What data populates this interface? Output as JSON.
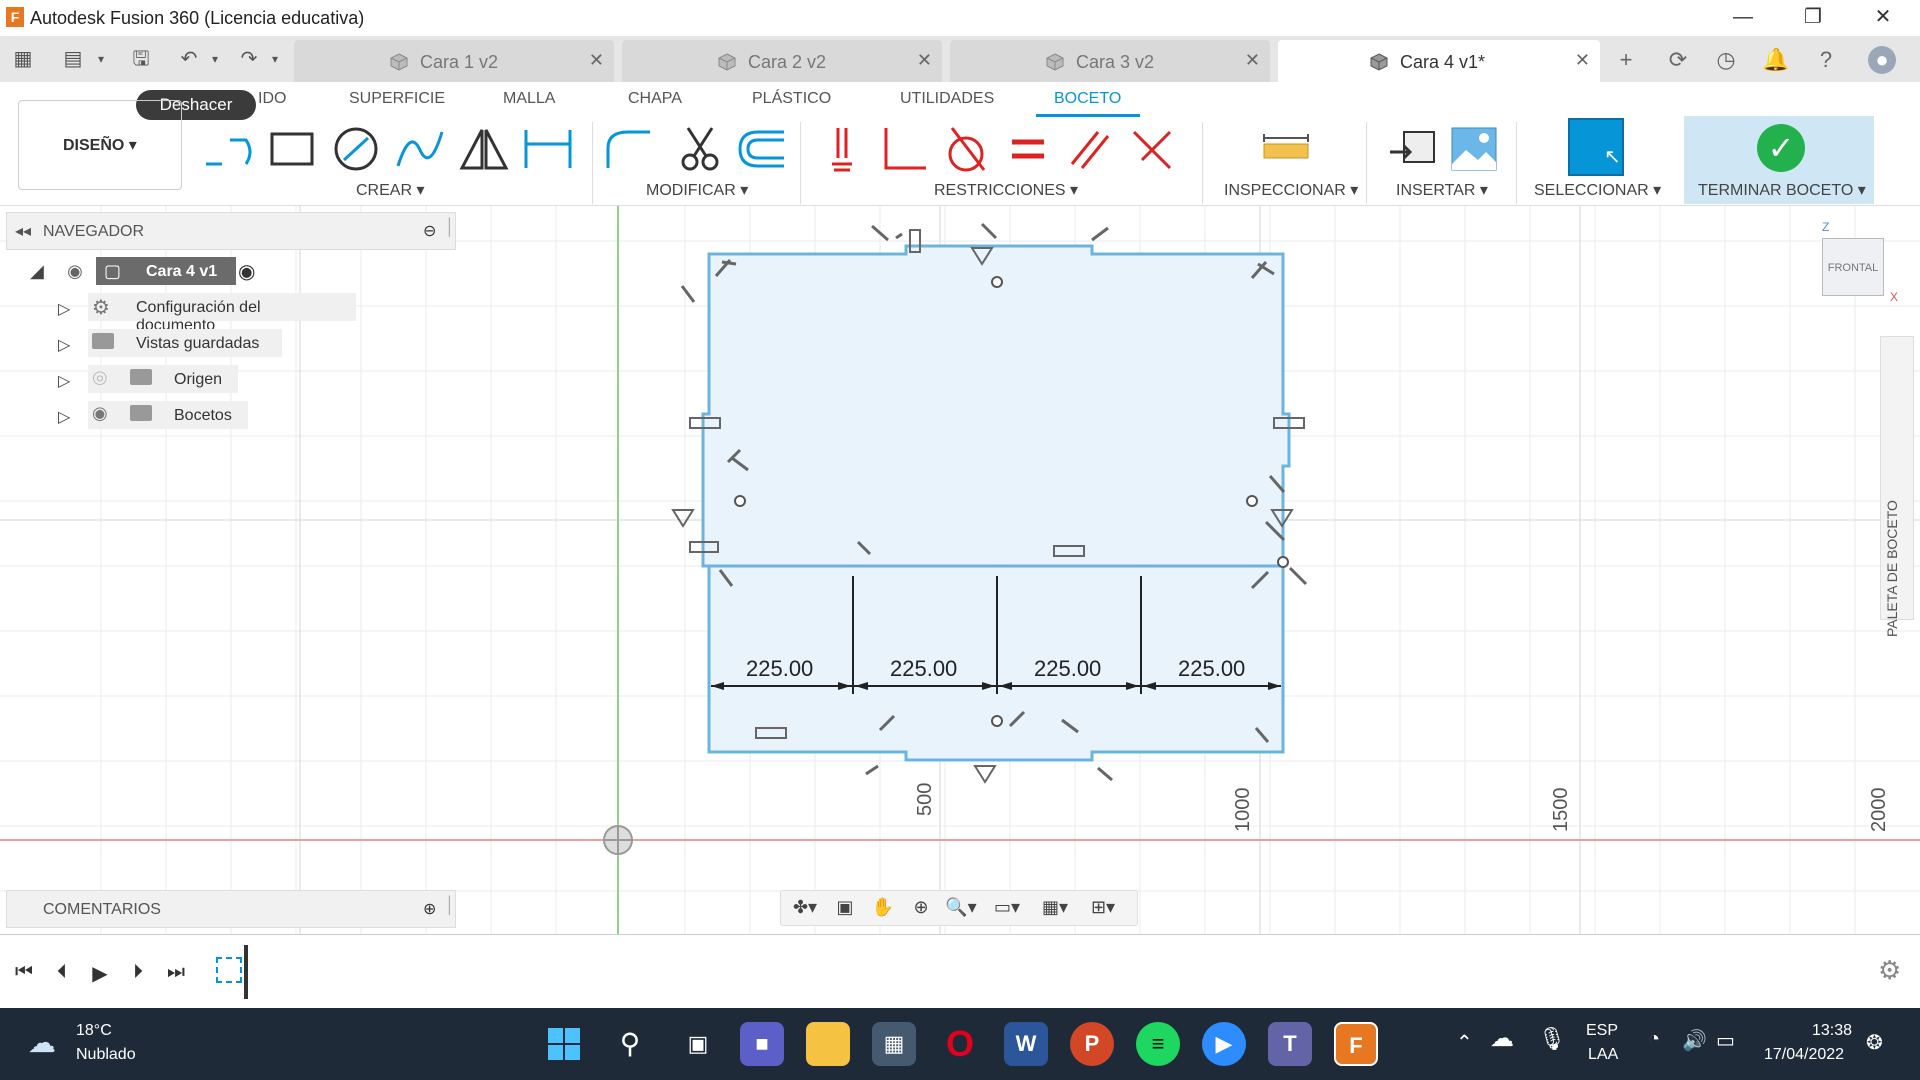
{
  "window": {
    "title": "Autodesk Fusion 360 (Licencia educativa)",
    "app_logo": "F"
  },
  "tabs": [
    {
      "label": "Cara 1 v2",
      "active": false
    },
    {
      "label": "Cara 2 v2",
      "active": false
    },
    {
      "label": "Cara 3 v2",
      "active": false
    },
    {
      "label": "Cara 4 v1*",
      "active": true
    }
  ],
  "ribbon": {
    "tooltip": "Deshacer",
    "tabs": [
      "IDO",
      "SUPERFICIE",
      "MALLA",
      "CHAPA",
      "PLÁSTICO",
      "UTILIDADES",
      "BOCETO"
    ],
    "workspace": "DISEÑO",
    "groups": {
      "crear": "CREAR",
      "modificar": "MODIFICAR",
      "restricciones": "RESTRICCIONES",
      "inspeccionar": "INSPECCIONAR",
      "insertar": "INSERTAR",
      "seleccionar": "SELECCIONAR",
      "terminar": "TERMINAR BOCETO"
    }
  },
  "navigator": {
    "title": "NAVEGADOR",
    "root": "Cara 4 v1",
    "items": [
      {
        "label": "Configuración del documento",
        "icon": "gear-icon"
      },
      {
        "label": "Vistas guardadas",
        "icon": "folder-icon"
      },
      {
        "label": "Origen",
        "icon": "folder-icon"
      },
      {
        "label": "Bocetos",
        "icon": "folder-icon"
      }
    ]
  },
  "comments": {
    "title": "COMENTARIOS"
  },
  "palette": {
    "label": "PALETA DE BOCETO"
  },
  "viewcube": {
    "face": "FRONTAL",
    "axis_z": "Z",
    "axis_x": "X"
  },
  "dimensions": [
    "225.00",
    "225.00",
    "225.00",
    "225.00"
  ],
  "axis_labels": [
    "500",
    "1000",
    "1500",
    "2000"
  ],
  "taskbar": {
    "weather_temp": "18°C",
    "weather_desc": "Nublado",
    "lang": "ESP",
    "lang_sub": "LAA",
    "time": "13:38",
    "date": "17/04/2022"
  },
  "colors": {
    "accent": "#0696d7",
    "sketch_fill": "#e8f3fb",
    "sketch_line": "#6cb4e0",
    "confirm": "#22b14c",
    "taskbar": "#1f2a38"
  }
}
